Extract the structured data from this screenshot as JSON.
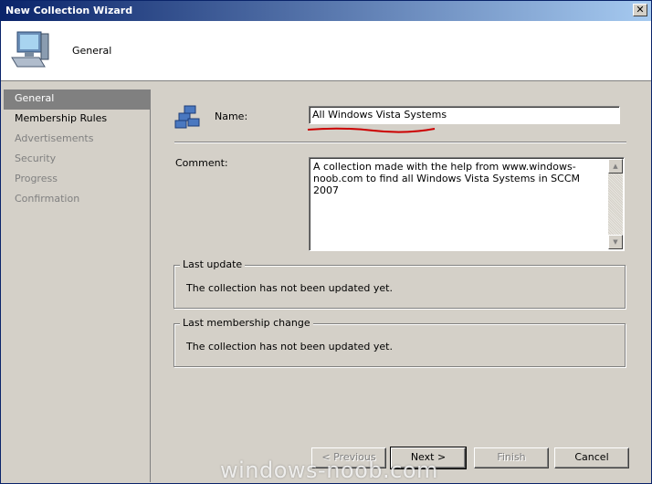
{
  "window": {
    "title": "New Collection Wizard"
  },
  "header": {
    "page_name": "General"
  },
  "nav": {
    "items": [
      {
        "label": "General",
        "state": "selected"
      },
      {
        "label": "Membership Rules",
        "state": "enabled"
      },
      {
        "label": "Advertisements",
        "state": "disabled"
      },
      {
        "label": "Security",
        "state": "disabled"
      },
      {
        "label": "Progress",
        "state": "disabled"
      },
      {
        "label": "Confirmation",
        "state": "disabled"
      }
    ]
  },
  "form": {
    "name_label": "Name:",
    "name_value": "All Windows Vista Systems",
    "comment_label": "Comment:",
    "comment_value": "A collection made with the help from www.windows-noob.com to find all Windows Vista Systems in SCCM 2007"
  },
  "last_update": {
    "legend": "Last update",
    "text": "The collection has not been updated yet."
  },
  "last_membership_change": {
    "legend": "Last membership change",
    "text": "The collection has not been updated yet."
  },
  "buttons": {
    "previous": "< Previous",
    "next": "Next >",
    "finish": "Finish",
    "cancel": "Cancel"
  },
  "watermark": "windows-noob.com",
  "colors": {
    "titlebar": "#0a246a",
    "selected_nav": "#808080",
    "annotation": "#cc0000"
  }
}
